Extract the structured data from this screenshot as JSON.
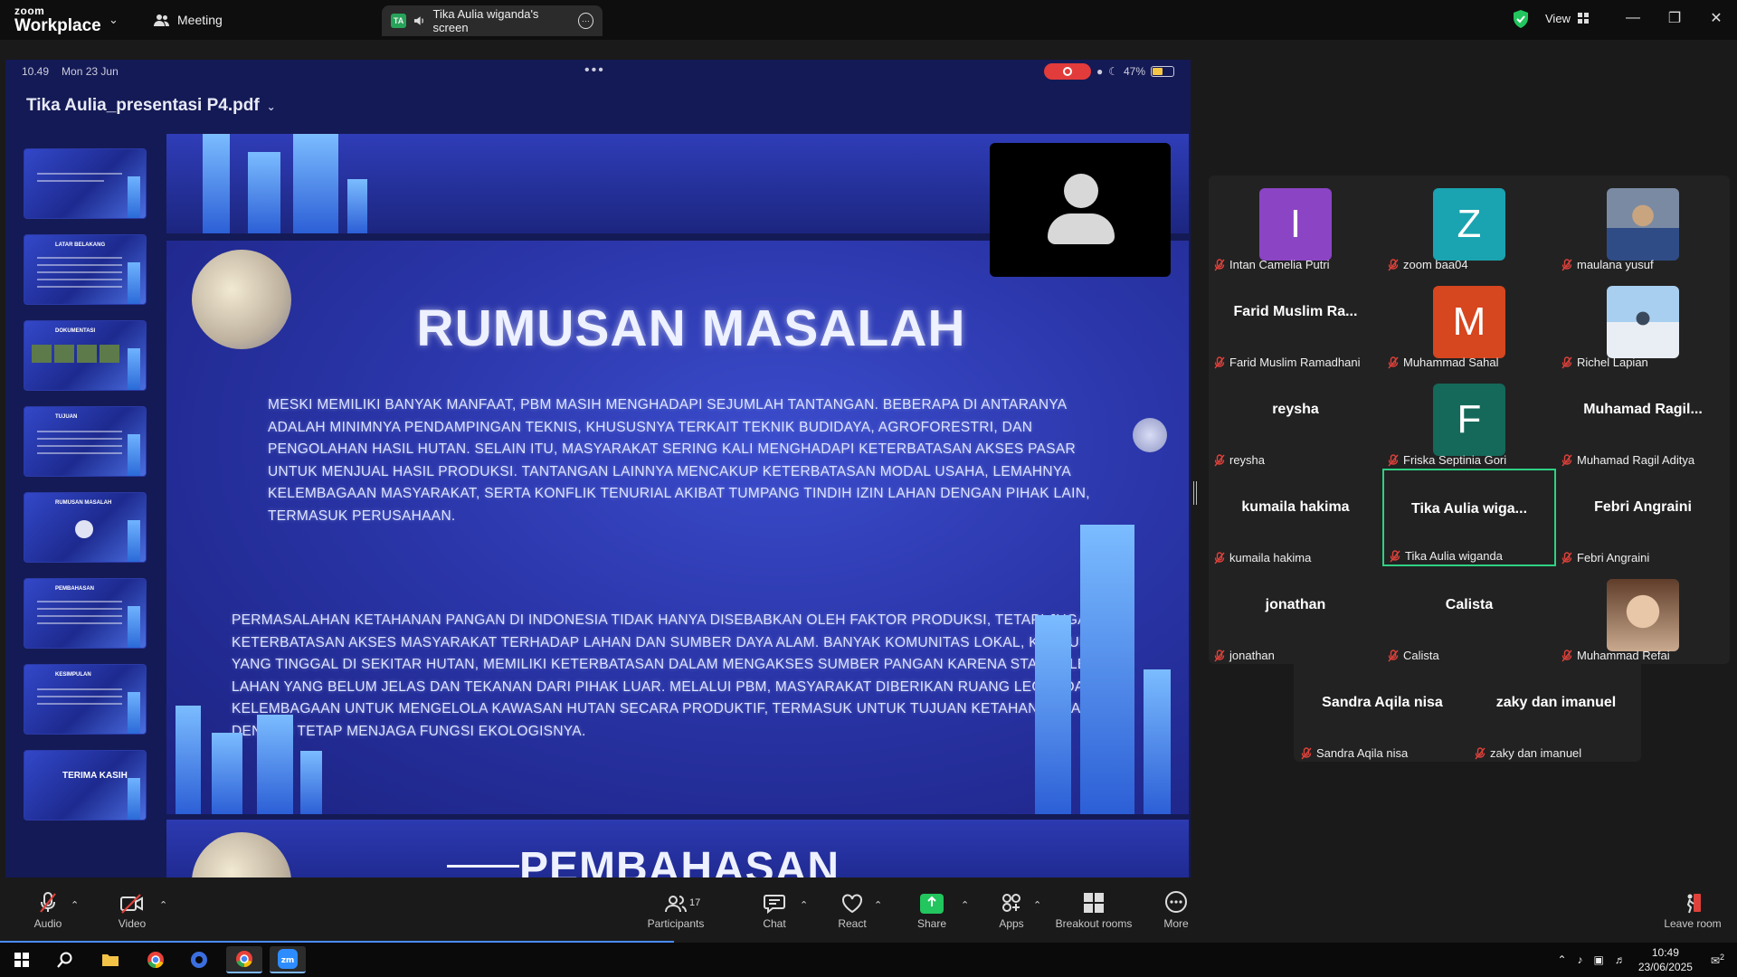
{
  "titlebar": {
    "brand_top": "zoom",
    "brand_main": "Workplace",
    "meeting_tab": "Meeting",
    "share_tab_badge": "TA",
    "share_tab_label": "Tika Aulia wiganda's screen",
    "view_label": "View"
  },
  "shared_screen": {
    "time": "10.49",
    "date": "Mon 23 Jun",
    "battery": "47%",
    "document_title": "Tika Aulia_presentasi P4.pdf",
    "thumbnails": [
      "",
      "LATAR BELAKANG",
      "DOKUMENTASI",
      "TUJUAN",
      "RUMUSAN MASALAH",
      "PEMBAHASAN",
      "KESIMPULAN",
      "TERIMA KASIH"
    ],
    "slide_heading": "RUMUSAN MASALAH",
    "slide_paragraph_1": "Meski memiliki banyak manfaat, PBM masih menghadapi sejumlah tantangan. Beberapa di antaranya adalah minimnya pendampingan teknis, khususnya terkait teknik budidaya, agroforestri, dan pengolahan hasil hutan. Selain itu, masyarakat sering kali menghadapi keterbatasan akses pasar untuk menjual hasil produksi. Tantangan lainnya mencakup keterbatasan modal usaha, lemahnya kelembagaan masyarakat, serta konflik tenurial akibat tumpang tindih izin lahan dengan pihak lain, termasuk perusahaan.",
    "slide_paragraph_2": "Permasalahan ketahanan pangan di Indonesia tidak hanya disebabkan oleh faktor produksi, tetapi juga oleh keterbatasan akses masyarakat terhadap lahan dan sumber daya alam. Banyak komunitas lokal, khususnya yang tinggal di sekitar hutan, memiliki keterbatasan dalam mengakses sumber pangan karena status legal lahan yang belum jelas dan tekanan dari pihak luar. Melalui PBM, masyarakat diberikan ruang legal dan kelembagaan untuk mengelola kawasan hutan secara produktif, termasuk untuk tujuan ketahanan pangan, dengan tetap menjaga fungsi ekologisnya.",
    "next_slide_heading": "PEMBAHASAN"
  },
  "participants": [
    {
      "display": "I",
      "name": "Intan Camelia Putri",
      "type": "letter",
      "color": "#8b44c4"
    },
    {
      "display": "Z",
      "name": "zoom baa04",
      "type": "letter",
      "color": "#1aa3b0"
    },
    {
      "display": "",
      "name": "maulana yusuf",
      "type": "photo",
      "color": "#5a6f8f"
    },
    {
      "display": "Farid Muslim Ra...",
      "name": "Farid Muslim Ramadhani",
      "type": "text",
      "color": ""
    },
    {
      "display": "M",
      "name": "Muhammad Sahal",
      "type": "letter",
      "color": "#d6461f"
    },
    {
      "display": "",
      "name": "Richel Lapian",
      "type": "photo",
      "color": "#a9c4dd"
    },
    {
      "display": "reysha",
      "name": "reysha",
      "type": "text",
      "color": ""
    },
    {
      "display": "F",
      "name": "Friska Septinia Gori",
      "type": "letter",
      "color": "#14695a"
    },
    {
      "display": "Muhamad Ragil...",
      "name": "Muhamad Ragil Aditya",
      "type": "text",
      "color": ""
    },
    {
      "display": "kumaila hakima",
      "name": "kumaila hakima",
      "type": "text",
      "color": ""
    },
    {
      "display": "Tika Aulia wiga...",
      "name": "Tika Aulia wiganda",
      "type": "text",
      "color": "",
      "active": true
    },
    {
      "display": "Febri Angraini",
      "name": "Febri Angraini",
      "type": "text",
      "color": ""
    },
    {
      "display": "jonathan",
      "name": "jonathan",
      "type": "text",
      "color": ""
    },
    {
      "display": "Calista",
      "name": "Calista",
      "type": "text",
      "color": ""
    },
    {
      "display": "",
      "name": "Muhammad Refai",
      "type": "photo",
      "color": "#c8a98e"
    },
    {
      "display": "Sandra Aqila nisa",
      "name": "Sandra Aqila nisa",
      "type": "text",
      "color": ""
    },
    {
      "display": "zaky dan imanuel",
      "name": "zaky dan imanuel",
      "type": "text",
      "color": ""
    }
  ],
  "toolbar": {
    "audio": "Audio",
    "video": "Video",
    "participants": "Participants",
    "participants_count": "17",
    "chat": "Chat",
    "react": "React",
    "share": "Share",
    "apps": "Apps",
    "breakout": "Breakout rooms",
    "more": "More",
    "leave": "Leave room"
  },
  "taskbar": {
    "time": "10:49",
    "date": "23/06/2025",
    "notifications": "2"
  },
  "colors": {
    "accent_green": "#22c55e",
    "active_border": "#2fd084",
    "muted_red": "#e0413b"
  }
}
